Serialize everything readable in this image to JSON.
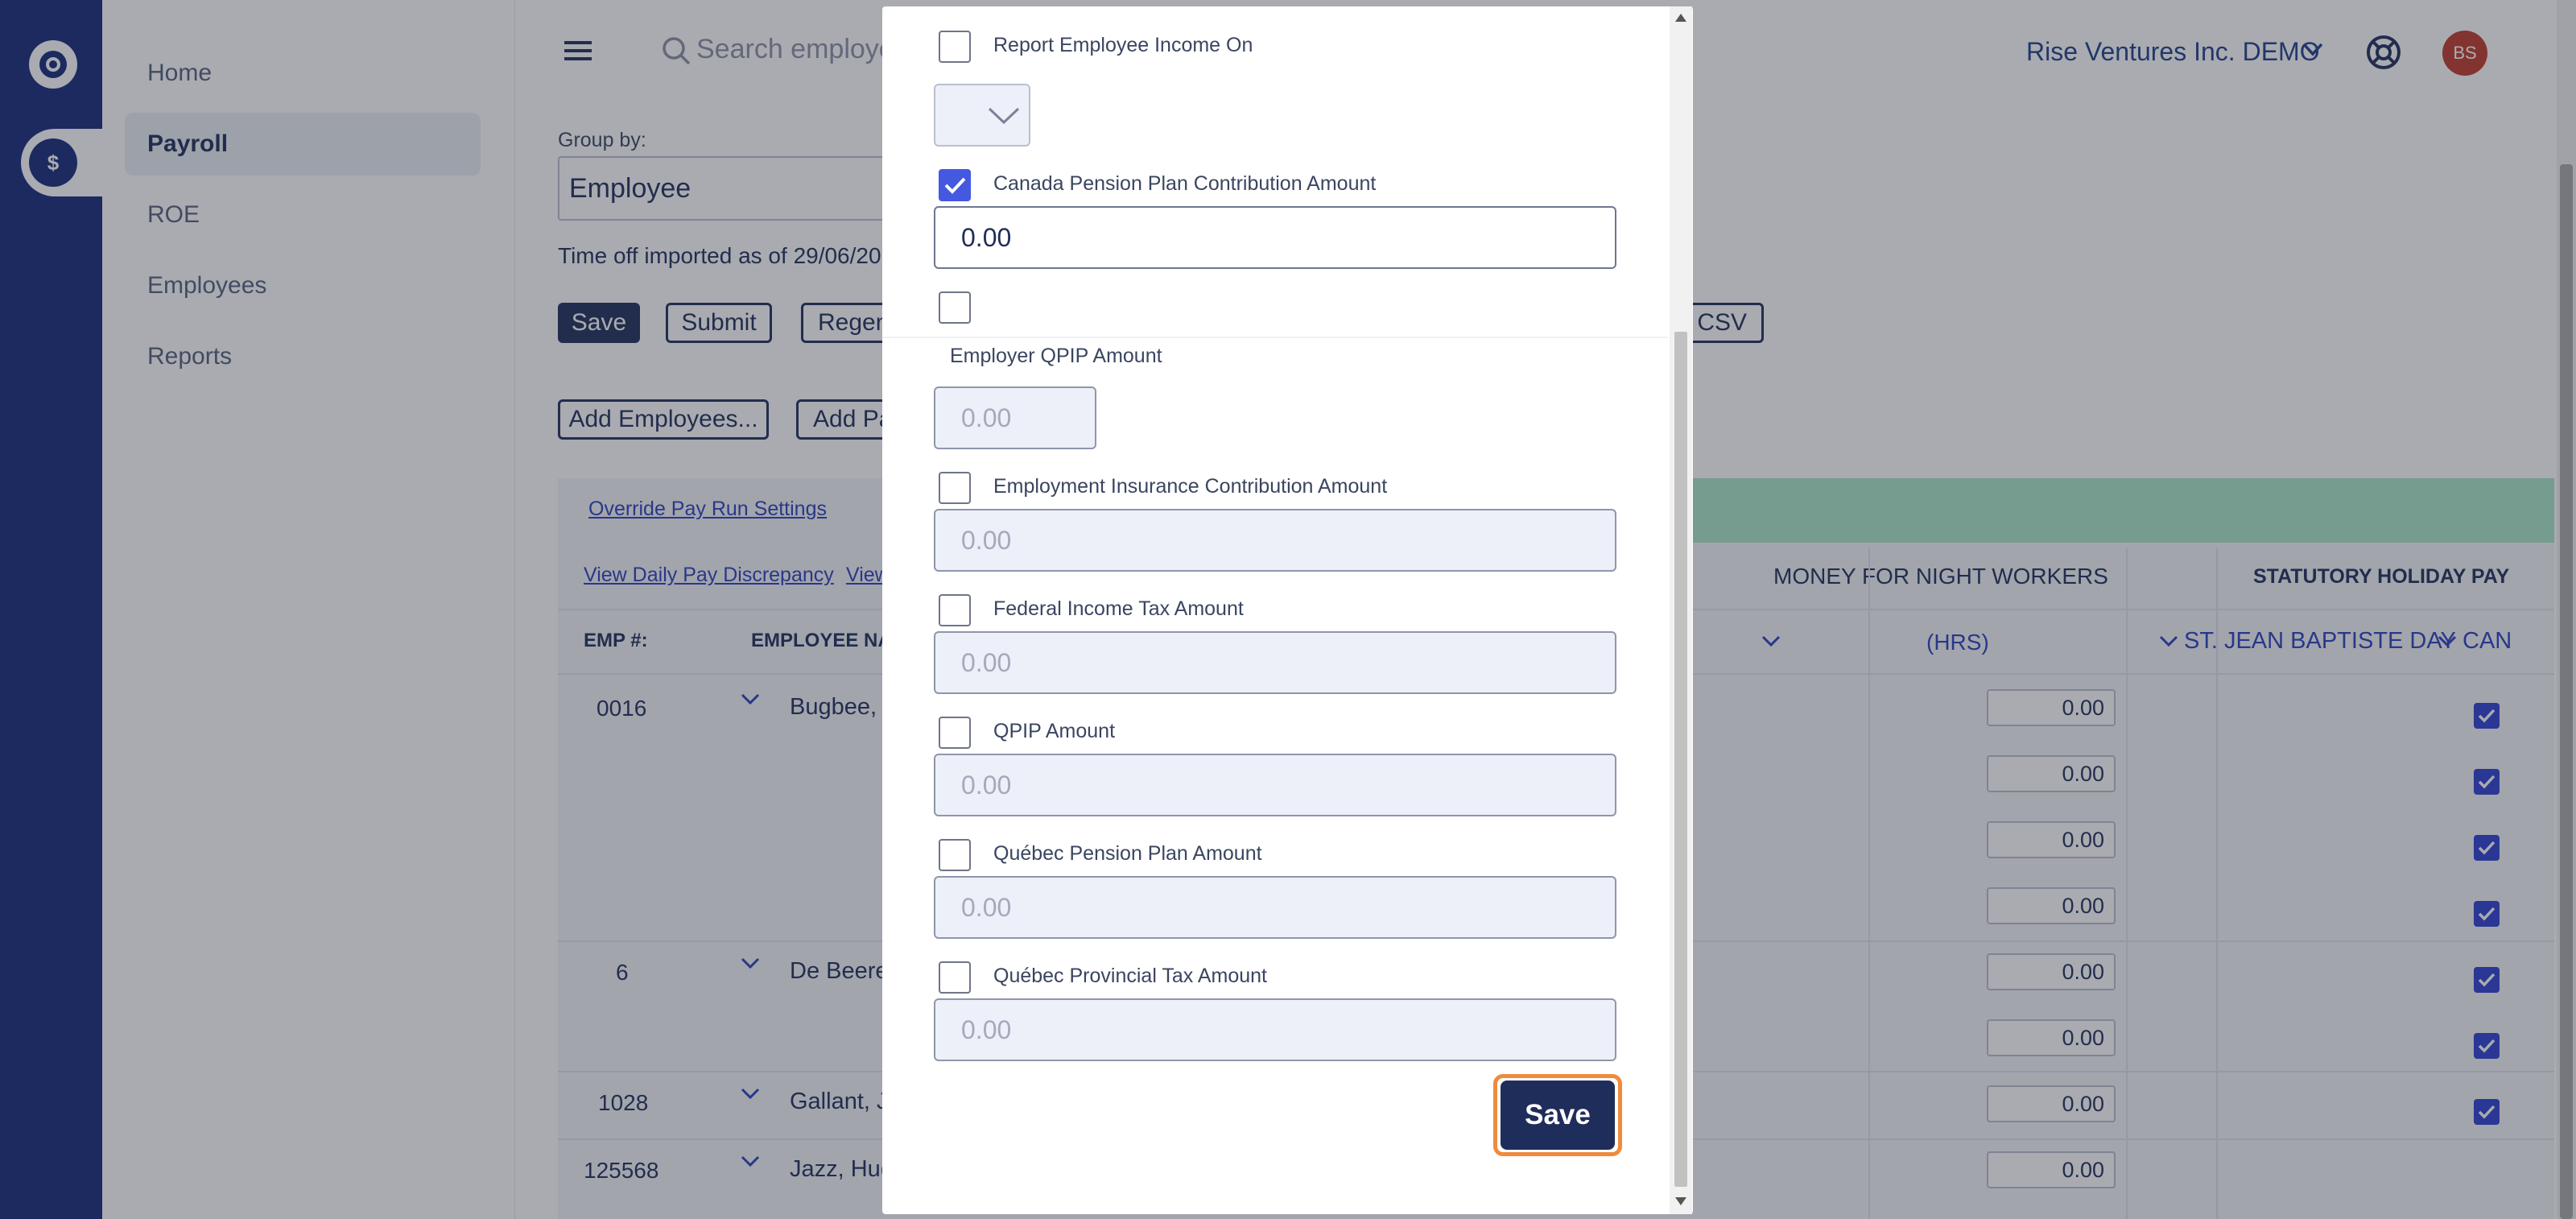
{
  "rail": {
    "apps": [
      "app-logo",
      "payroll-app"
    ]
  },
  "sidebar": {
    "items": [
      {
        "label": "Home",
        "active": false
      },
      {
        "label": "Payroll",
        "active": true
      },
      {
        "label": "ROE",
        "active": false
      },
      {
        "label": "Employees",
        "active": false
      },
      {
        "label": "Reports",
        "active": false
      }
    ]
  },
  "header": {
    "search_placeholder": "Search employe",
    "company": "Rise Ventures Inc. DEMO",
    "avatar_initials": "BS"
  },
  "main": {
    "group_by_label": "Group by:",
    "group_by_value": "Employee",
    "time_off_text": "Time off imported as of 29/06/20",
    "buttons": {
      "save": "Save",
      "submit": "Submit",
      "regen": "Regen",
      "csv": "t As CSV",
      "add_employees": "Add Employees...",
      "add_pay": "Add Pa"
    },
    "links": {
      "override": "Override Pay Run Settings",
      "daily": "View Daily Pay Discrepancy",
      "view2": "View"
    },
    "table": {
      "headers": {
        "emp": "EMP #:",
        "name": "EMPLOYEE NA",
        "paren": ")",
        "night": "MONEY FOR NIGHT WORKERS",
        "stat": "STATUTORY HOLIDAY PAY",
        "hrs": "(HRS)",
        "jean": "ST. JEAN BAPTISTE DAY",
        "can": "CAN"
      },
      "rows": [
        {
          "emp": "0016",
          "name": "Bugbee,"
        },
        {
          "emp": "6",
          "name": "De Beere"
        },
        {
          "emp": "1028",
          "name": "Gallant, J"
        },
        {
          "emp": "125568",
          "name": "Jazz, Hug"
        }
      ],
      "cell_values": [
        "0.00",
        "0.00",
        "0.00",
        "0.00",
        "0.00",
        "0.00",
        "0.00",
        "0.00"
      ],
      "partial_values": [
        "0",
        "0"
      ]
    }
  },
  "modal": {
    "fields": [
      {
        "label": "Report Employee Income On",
        "checked": false
      },
      {
        "label": "Canada Pension Plan Contribution Amount",
        "checked": true,
        "value": "0.00"
      },
      {
        "label": "",
        "checked": false
      },
      {
        "label": "Employer QPIP Amount",
        "value": "0.00"
      },
      {
        "label": "Employment Insurance Contribution Amount",
        "checked": false,
        "value": "0.00"
      },
      {
        "label": "Federal Income Tax Amount",
        "checked": false,
        "value": "0.00"
      },
      {
        "label": "QPIP Amount",
        "checked": false,
        "value": "0.00"
      },
      {
        "label": "Québec Pension Plan Amount",
        "checked": false,
        "value": "0.00"
      },
      {
        "label": "Québec Provincial Tax Amount",
        "checked": false,
        "value": "0.00"
      }
    ],
    "save_label": "Save"
  },
  "colors": {
    "brand": "#15287a",
    "button": "#1f2d5a",
    "checkbox": "#4458e0",
    "focus_ring": "#f08a3c",
    "avatar": "#c0392b",
    "band": "#a8e6c9"
  }
}
